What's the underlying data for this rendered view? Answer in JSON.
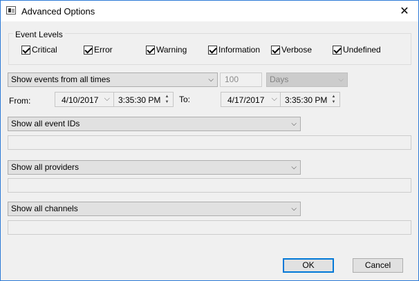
{
  "window": {
    "title": "Advanced Options",
    "close_glyph": "✕"
  },
  "event_levels": {
    "legend": "Event Levels",
    "items": [
      {
        "label": "Critical",
        "checked": true
      },
      {
        "label": "Error",
        "checked": true
      },
      {
        "label": "Warning",
        "checked": true
      },
      {
        "label": "Information",
        "checked": true
      },
      {
        "label": "Verbose",
        "checked": true
      },
      {
        "label": "Undefined",
        "checked": true
      }
    ]
  },
  "time_filter": {
    "range_select": "Show events from all times",
    "count_value": "100",
    "unit_select": "Days",
    "from_label": "From:",
    "from_date": "4/10/2017",
    "from_time": "3:35:30 PM",
    "to_label": "To:",
    "to_date": "4/17/2017",
    "to_time": "3:35:30 PM"
  },
  "event_ids": {
    "select": "Show all event IDs",
    "input": ""
  },
  "providers": {
    "select": "Show all providers",
    "input": ""
  },
  "channels": {
    "select": "Show all channels",
    "input": ""
  },
  "buttons": {
    "ok": "OK",
    "cancel": "Cancel"
  },
  "icons": {
    "dropdown": "chevron-down-icon",
    "spin_up": "▲",
    "spin_down": "▼",
    "arrow": "⌵"
  },
  "colors": {
    "window_border": "#2b79d6",
    "default_button_border": "#0078d7",
    "dialog_bg": "#f0f0f0"
  }
}
